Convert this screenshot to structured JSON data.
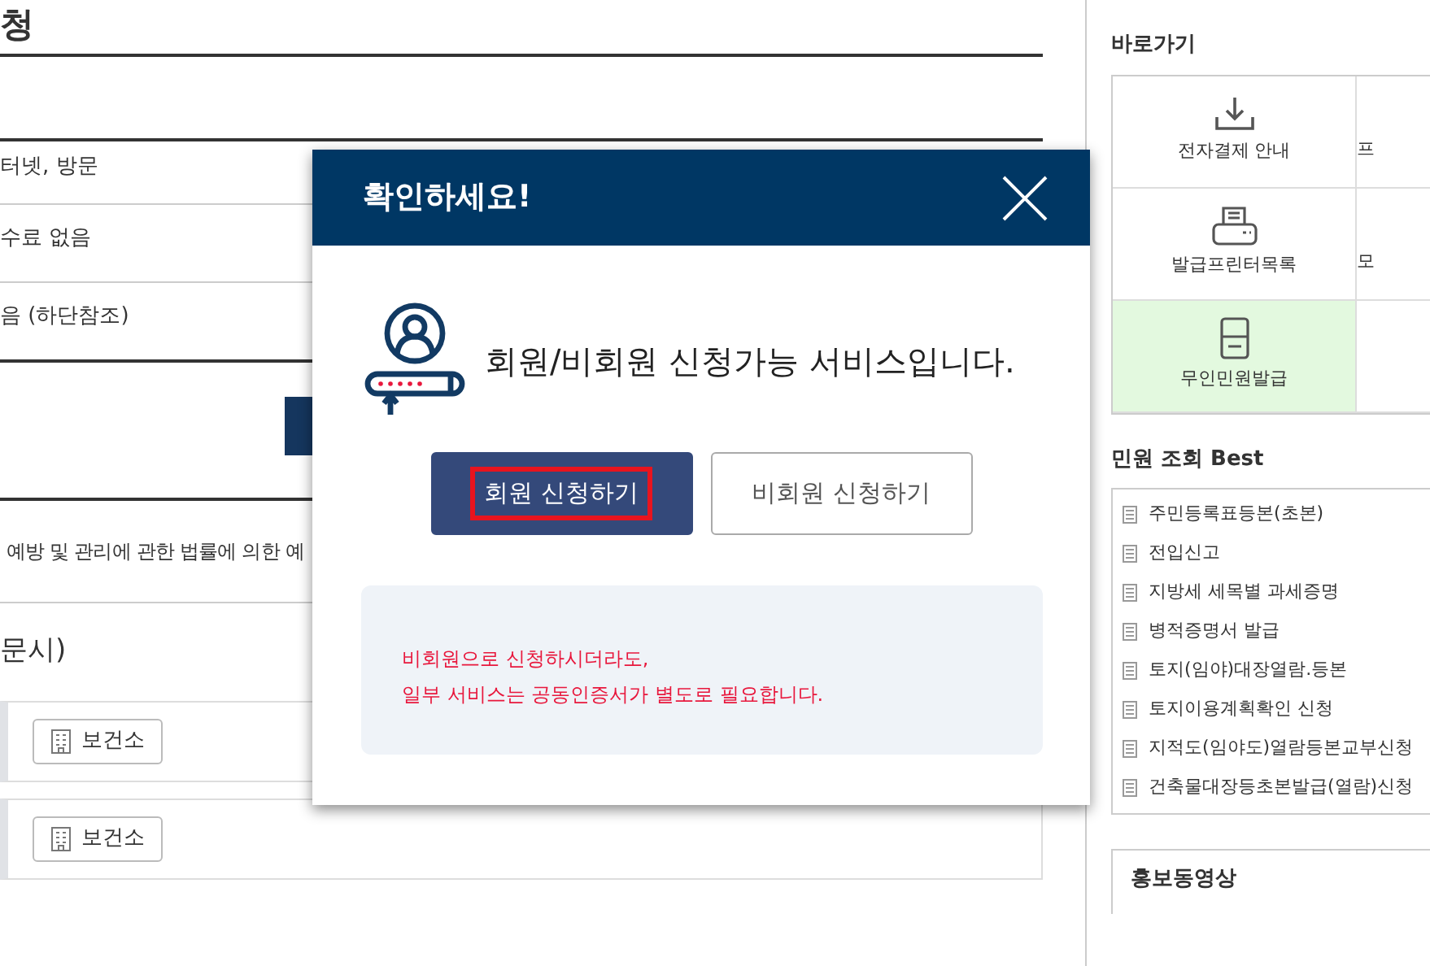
{
  "page_title": "청",
  "info_rows": [
    {
      "value": "터넷, 방문"
    },
    {
      "value": "수료 없음"
    },
    {
      "value": "음 (하단참조)"
    }
  ],
  "law_text": "예방 및 관리에 관한 법률에 의한 예",
  "section_heading": "문시)",
  "agency_buttons": [
    {
      "label": "보건소"
    },
    {
      "label": "보건소"
    }
  ],
  "sidebar": {
    "shortcuts_title": "바로가기",
    "shortcuts": [
      {
        "label": "전자결제 안내",
        "kind": "download",
        "selected": false
      },
      {
        "label": "프",
        "kind": "cut",
        "selected": false
      },
      {
        "label": "발급프린터목록",
        "kind": "printer",
        "selected": false
      },
      {
        "label": "모",
        "kind": "cut",
        "selected": false
      },
      {
        "label": "무인민원발급",
        "kind": "kiosk",
        "selected": true
      },
      {
        "kind": "cut",
        "selected": false
      }
    ],
    "best_title": "민원 조회 Best",
    "best_items": [
      "주민등록표등본(초본)",
      "전입신고",
      "지방세 세목별 과세증명",
      "병적증명서 발급",
      "토지(임야)대장열람.등본",
      "토지이용계획확인 신청",
      "지적도(임야도)열람등본교부신청",
      "건축물대장등초본발급(열람)신청"
    ],
    "video_title": "홍보동영상"
  },
  "modal": {
    "title": "확인하세요!",
    "message": "회원/비회원 신청가능 서비스입니다.",
    "buttons": [
      {
        "label": "회원 신청하기",
        "kind": "primary",
        "highlighted": true
      },
      {
        "label": "비회원 신청하기",
        "kind": "outline",
        "highlighted": false
      }
    ],
    "notice": [
      "비회원으로 신청하시더라도,",
      "일부 서비스는 공동인증서가 별도로 필요합니다."
    ]
  }
}
